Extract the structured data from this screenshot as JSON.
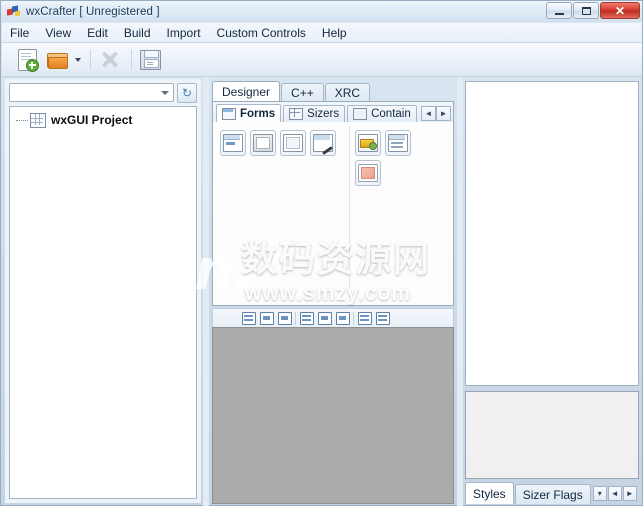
{
  "window": {
    "title": "wxCrafter [ Unregistered ]",
    "app_icon": "wxcrafter-logo-icon",
    "controls": {
      "minimize": "minimize-icon",
      "maximize": "maximize-icon",
      "close": "✕"
    }
  },
  "menubar": {
    "items": [
      {
        "label": "File"
      },
      {
        "label": "View"
      },
      {
        "label": "Edit"
      },
      {
        "label": "Build"
      },
      {
        "label": "Import"
      },
      {
        "label": "Custom Controls"
      },
      {
        "label": "Help"
      }
    ]
  },
  "toolbar": {
    "buttons": [
      {
        "name": "new-project",
        "icon": "new-page-icon"
      },
      {
        "name": "open-project",
        "icon": "open-folder-icon",
        "has_dropdown": true
      },
      {
        "name": "close-project",
        "icon": "close-x-icon",
        "disabled": true
      },
      {
        "name": "save-project",
        "icon": "save-disk-icon"
      }
    ]
  },
  "left_panel": {
    "combo": {
      "value": "",
      "placeholder": ""
    },
    "refresh_icon": "↻",
    "tree": {
      "items": [
        {
          "label": "wxGUI Project",
          "icon": "project-grid-icon"
        }
      ]
    }
  },
  "center_panel": {
    "tabs": [
      {
        "label": "Designer",
        "active": true
      },
      {
        "label": "C++",
        "active": false
      },
      {
        "label": "XRC",
        "active": false
      }
    ],
    "palette_tabs": [
      {
        "label": "Forms",
        "active": true,
        "icon": "window-icon"
      },
      {
        "label": "Sizers",
        "active": false,
        "icon": "grid-icon"
      },
      {
        "label": "Contain",
        "active": false,
        "icon": "folder-icon"
      }
    ],
    "palette_scroll": {
      "left": "◄",
      "right": "►"
    },
    "palette_items_group1": [
      {
        "name": "wxframe-item",
        "style": "a"
      },
      {
        "name": "wxdialog-item",
        "style": "b"
      },
      {
        "name": "wxpanel-item",
        "style": "c"
      },
      {
        "name": "wxwizard-item",
        "style": "d"
      }
    ],
    "palette_items_group2": [
      {
        "name": "wxmenubar-item",
        "style": "e"
      },
      {
        "name": "wxtoolbar-item",
        "style": "f"
      },
      {
        "name": "wximagelist-item",
        "style": "g"
      }
    ],
    "designer_toolbar": [
      {
        "name": "align-left-button",
        "style": "s"
      },
      {
        "name": "align-center-button",
        "style": "alt"
      },
      {
        "name": "align-right-button",
        "style": "alt"
      },
      {
        "name": "expand-button",
        "style": "s"
      },
      {
        "name": "border-top-button",
        "style": "alt"
      },
      {
        "name": "border-bottom-button",
        "style": "alt"
      },
      {
        "name": "wrap-button",
        "style": "s"
      },
      {
        "name": "grid-toggle-button",
        "style": "s"
      }
    ]
  },
  "right_panel": {
    "property_grid": {
      "rows": []
    },
    "preview_box": {},
    "tabs": [
      {
        "label": "Styles",
        "active": true
      },
      {
        "label": "Sizer Flags",
        "active": false
      }
    ],
    "tab_scroll": {
      "menu": "▾",
      "left": "◄",
      "right": "►"
    }
  },
  "watermark": {
    "logo": "sm",
    "chinese": "数码资源网",
    "url": "www.smzy.com"
  },
  "colors": {
    "canvas_gray": "#ababab",
    "title_blue": "#14385c",
    "close_red": "#d5392c",
    "accent_green": "#5fae3c",
    "folder_orange": "#e7963c"
  }
}
